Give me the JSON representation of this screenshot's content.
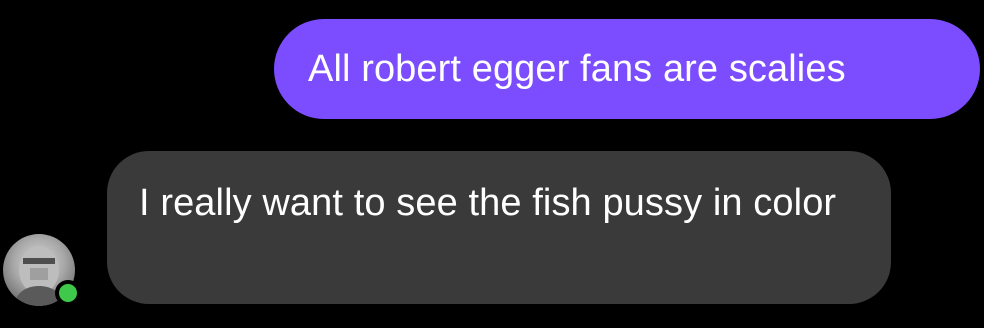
{
  "colors": {
    "background": "#000000",
    "sent_bubble": "#7b4dff",
    "received_bubble": "#3a3a3a",
    "text": "#ffffff",
    "presence_online": "#3fc94a"
  },
  "messages": [
    {
      "direction": "sent",
      "text": "All robert egger fans are scalies"
    },
    {
      "direction": "received",
      "text": "I really want to see the fish pussy in color"
    }
  ],
  "sender": {
    "avatar_icon": "profile-photo-icon",
    "presence": "online"
  }
}
